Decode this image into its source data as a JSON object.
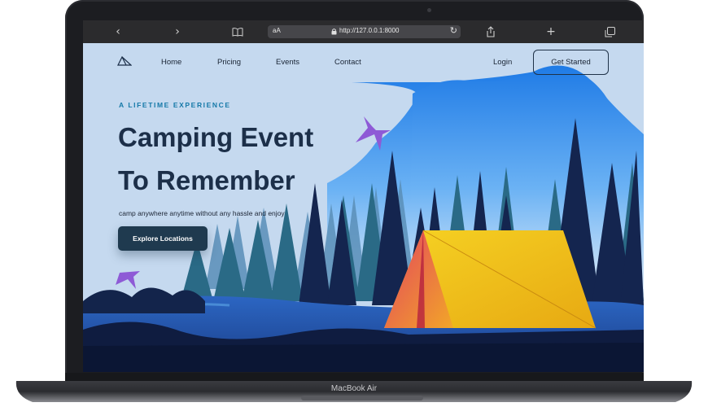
{
  "device": {
    "label": "MacBook Air"
  },
  "browser": {
    "text_size_label": "aA",
    "url": "http://127.0.0.1:8000",
    "icons": [
      "chevron-left-icon",
      "chevron-right-icon",
      "book-icon",
      "lock-icon",
      "reload-icon",
      "share-icon",
      "plus-icon",
      "tabs-icon"
    ]
  },
  "nav": {
    "links": [
      "Home",
      "Pricing",
      "Events",
      "Contact"
    ],
    "login": "Login",
    "cta": "Get Started"
  },
  "hero": {
    "eyebrow": "A LIFETIME EXPERIENCE",
    "title_line1": "Camping Event",
    "title_line2": "To Remember",
    "subtitle": "camp anywhere anytime without any hassle and enjoy",
    "button": "Explore Locations"
  },
  "colors": {
    "sky": "#c5d9ef",
    "title": "#1c2f49",
    "accent": "#1679a8",
    "button": "#1f3a4f",
    "tent": "#f2c21b",
    "bird": "#8e5ad6"
  }
}
